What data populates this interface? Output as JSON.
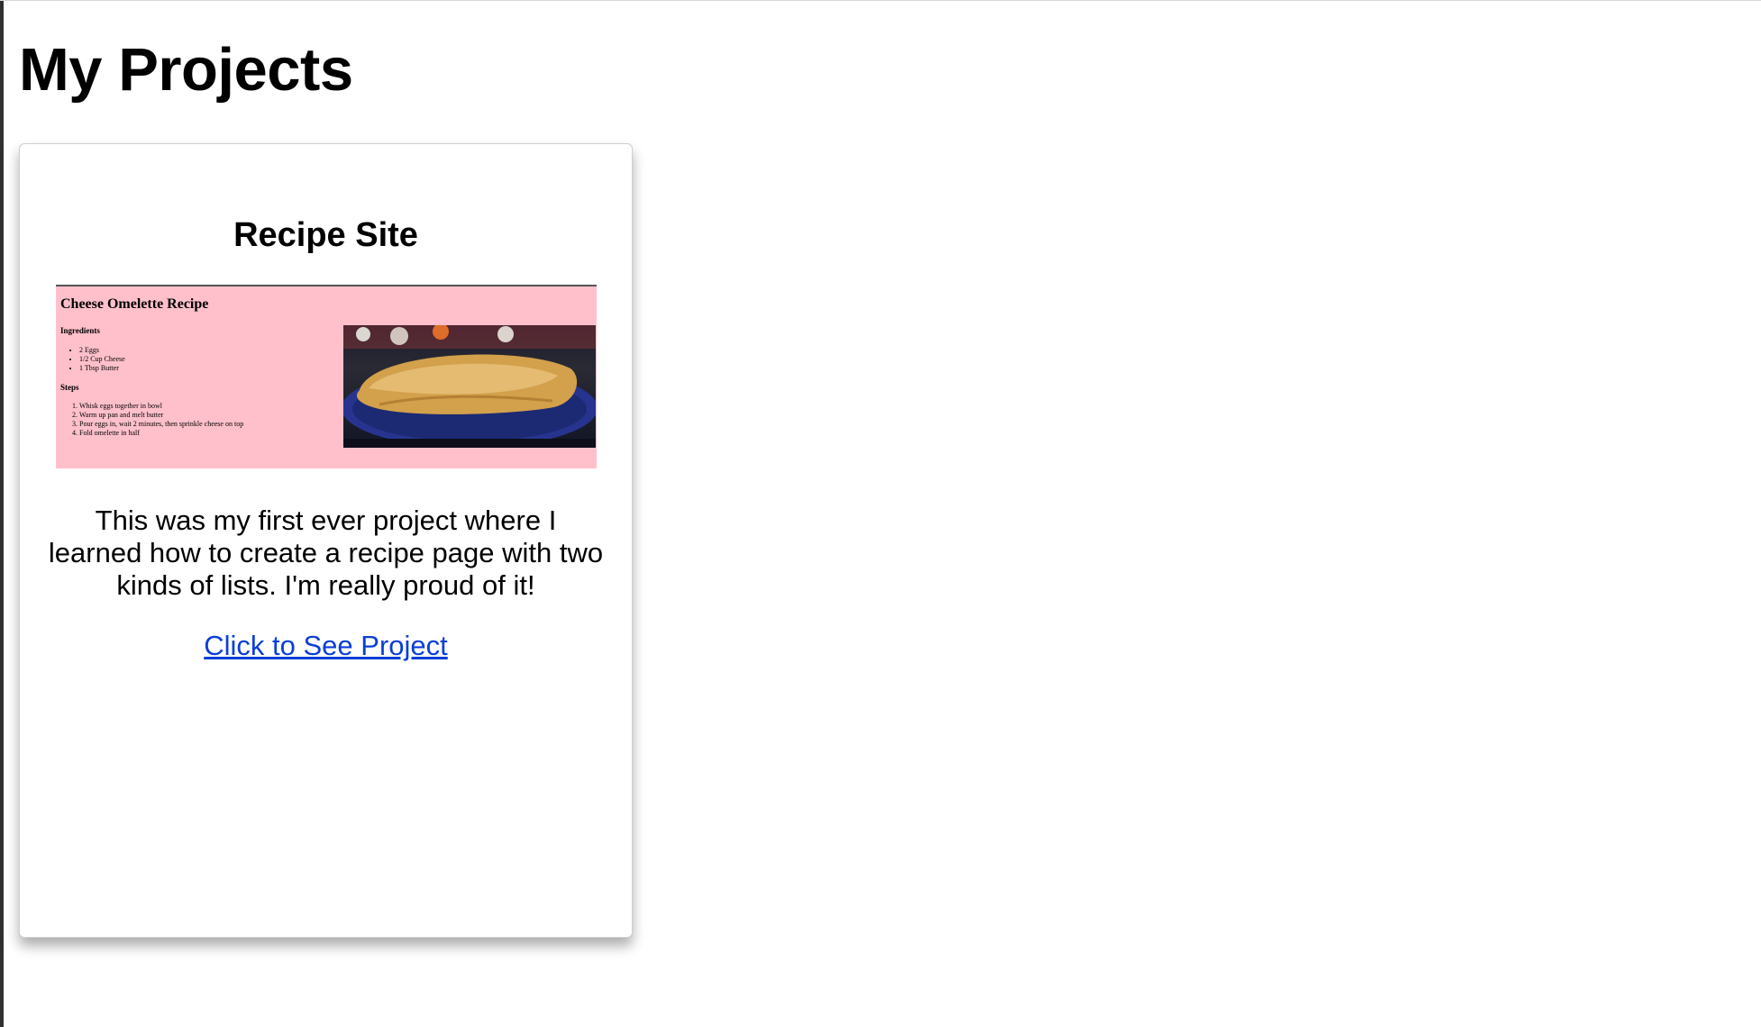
{
  "page": {
    "title": "My Projects"
  },
  "project_card": {
    "title": "Recipe Site",
    "description": "This was my first ever project where I learned how to create a recipe page with two kinds of lists. I'm really proud of it!",
    "link_label": "Click to See Project",
    "preview": {
      "title": "Cheese Omelette Recipe",
      "ingredients_heading": "Ingredients",
      "ingredients": [
        "2 Eggs",
        "1/2 Cup Cheese",
        "1 Tbsp Butter"
      ],
      "steps_heading": "Steps",
      "steps": [
        "Whisk eggs together in bowl",
        "Warm up pan and melt butter",
        "Pour eggs in, wait 2 minutes, then sprinkle cheese on top",
        "Fold omelette in half"
      ],
      "background_color": "#ffc0cb",
      "image": "omelette-photo"
    }
  },
  "colors": {
    "link": "#0b3ed6",
    "card_background": "#ffffff",
    "page_background": "#ffffff"
  }
}
